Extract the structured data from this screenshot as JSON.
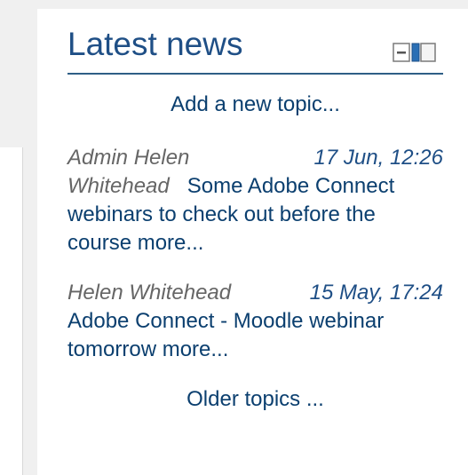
{
  "block": {
    "title": "Latest news",
    "add_topic_label": "Add a new topic...",
    "older_topics_label": "Older topics ...",
    "dock_icon": "dock-block-icon"
  },
  "posts": [
    {
      "author_line1": "Admin Helen",
      "author_line2": "Whitehead",
      "date": "17 Jun, 12:26",
      "subject_line1": "Some Adobe",
      "subject_rest": "Connect webinars to check out before the course",
      "more_label": "more..."
    },
    {
      "author": "Helen Whitehead",
      "date": "15 May, 17:24",
      "subject": "Adobe Connect - Moodle webinar tomorrow",
      "more_label": "more..."
    }
  ],
  "colors": {
    "link": "#0b3f6f",
    "title": "#1f4f86",
    "author": "#666666",
    "header_rule": "#2f5f86",
    "page_bg": "#f0f0f0",
    "block_bg": "#ffffff"
  }
}
